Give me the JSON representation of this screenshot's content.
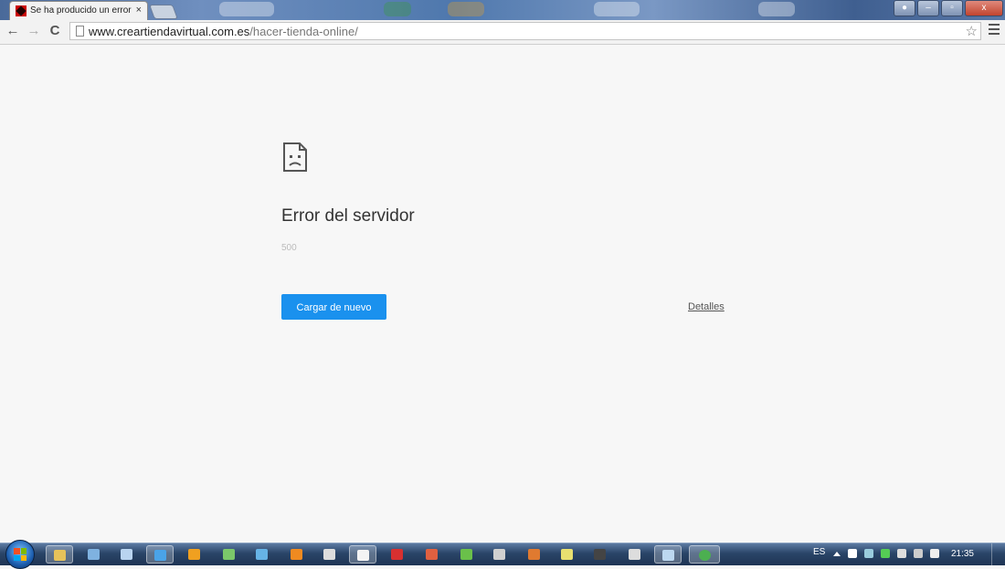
{
  "browser": {
    "tab": {
      "title": "Se ha producido un error",
      "close_glyph": "×"
    },
    "window_controls": {
      "minimize": "–",
      "maximize": "▫",
      "close": "x"
    },
    "toolbar": {
      "back_glyph": "←",
      "forward_glyph": "→",
      "reload_glyph": "C",
      "star_glyph": "☆"
    },
    "url": {
      "host": "www.creartiendavirtual.com.es",
      "path": "/hacer-tienda-online/"
    }
  },
  "page": {
    "title": "Error del servidor",
    "code": "500",
    "reload_label": "Cargar de nuevo",
    "details_label": "Detalles"
  },
  "taskbar": {
    "language": "ES",
    "time": "21:35",
    "apps": [
      {
        "icon": "explorer-icon",
        "color": "#e6c25a"
      },
      {
        "icon": "network-icon",
        "color": "#7fb2e0"
      },
      {
        "icon": "computer-icon",
        "color": "#b9d4f0"
      },
      {
        "icon": "internet-explorer-icon",
        "color": "#4aa3e8"
      },
      {
        "icon": "media-player-icon",
        "color": "#f0a020"
      },
      {
        "icon": "chart-app-icon",
        "color": "#7bc86a"
      },
      {
        "icon": "window-app-icon",
        "color": "#66b3e6"
      },
      {
        "icon": "flame-app-icon",
        "color": "#f08a20"
      },
      {
        "icon": "archive-7z-icon",
        "color": "#dddddd"
      },
      {
        "icon": "document-icon",
        "color": "#f4f4f4"
      },
      {
        "icon": "filezilla-icon",
        "color": "#d83030"
      },
      {
        "icon": "magnet-app-icon",
        "color": "#e06040"
      },
      {
        "icon": "utorrent-icon",
        "color": "#6ac04a"
      },
      {
        "icon": "calculator-icon",
        "color": "#d0d0d0"
      },
      {
        "icon": "paw-app-icon",
        "color": "#e07a30"
      },
      {
        "icon": "notepad-icon",
        "color": "#e8e070"
      },
      {
        "icon": "camera-app-icon",
        "color": "#444444"
      },
      {
        "icon": "archive-7z-icon",
        "color": "#dddddd"
      },
      {
        "icon": "window-switch-icon",
        "color": "#bcd8f0"
      },
      {
        "icon": "chrome-icon",
        "color": "#4caf50"
      }
    ]
  }
}
